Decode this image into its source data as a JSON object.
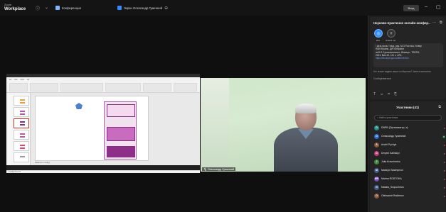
{
  "titlebar": {
    "brand_top": "Zoom",
    "brand": "Workplace",
    "tab_conference": "Конференция",
    "tab_screen": "Экран Олександр Гуменний",
    "sign_in": "Вход"
  },
  "share": {
    "notes": "Заметки к слайду",
    "status": "Слайд 8 из 10"
  },
  "video": {
    "label": "Олександр Гуменний"
  },
  "chat": {
    "title": "Науково-практичне онлайн-конфер...",
    "new_label_1": "Все",
    "new_label_2": "Новый чат",
    "message_lines": [
      "/ дезь фолк / наук. ред. М.О.Ростока; Універ",
      "НАКУКраїни, ДНПБУкраїни",
      "ім.В.О.Сухомлинського. Вінниця : ТВОРИ,",
      "2024. Вип.19. 121 с. URL:"
    ],
    "message_link": "https://lib.dnpb.gov.ua/item/6702/",
    "hint_line": "Кто может видеть ваши сообщения? Запись включена",
    "compose_placeholder": "Сообщение все"
  },
  "participants": {
    "title": "Участники (41)",
    "search_placeholder": "Найти участника",
    "colors": {
      "teal": "#1f8f86",
      "blue": "#2a6fd6",
      "pink": "#c43a7c",
      "green": "#3f8b3a",
      "purple": "#7a4bc2",
      "slate": "#3f5d8a",
      "brown": "#8a5a3a"
    },
    "list": [
      {
        "initial": "D",
        "name": "DNPB (Организатор, я)",
        "color": "teal"
      },
      {
        "initial": "О",
        "name": "Олександр Гуменний",
        "color": "blue"
      },
      {
        "initial": "A",
        "name": "Andrii Pyzhyk",
        "color": "brown"
      },
      {
        "initial": "D",
        "name": "Dmytrii Kalinskyi",
        "color": "pink"
      },
      {
        "initial": "J",
        "name": "Julia Kravchenko",
        "color": "green"
      },
      {
        "initial": "M",
        "name": "Maksym Makhymov",
        "color": "slate"
      },
      {
        "initial": "MR",
        "name": "Marina ROSTOKA",
        "color": "purple"
      },
      {
        "initial": "N",
        "name": "Natalia_Kropocheva",
        "color": "slate"
      },
      {
        "initial": "O",
        "name": "Oleksandr Radienov",
        "color": "brown"
      }
    ]
  }
}
